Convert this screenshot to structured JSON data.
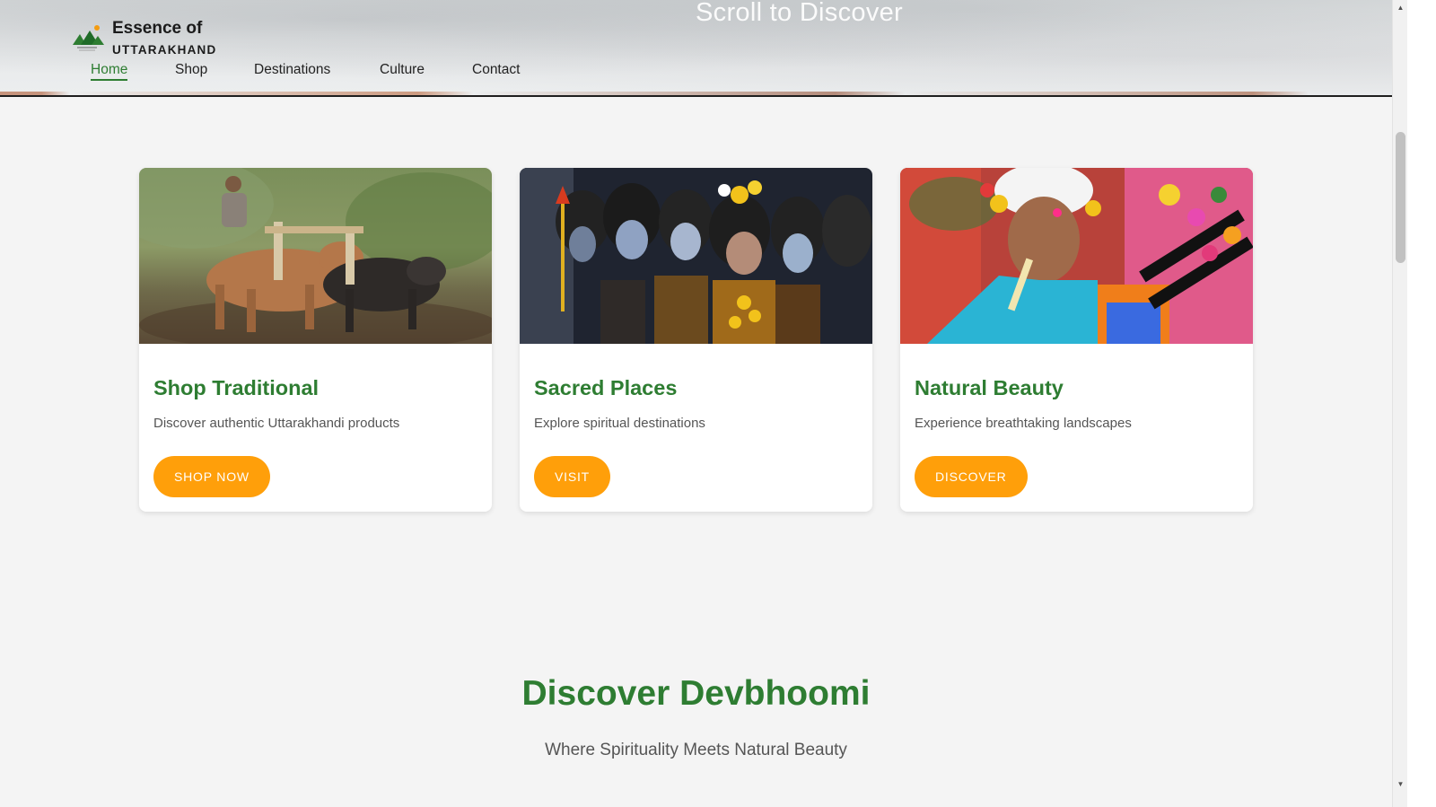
{
  "header": {
    "scroll_hint": "Scroll to Discover",
    "logo": {
      "line1": "Essence of",
      "line2": "UTTARAKHAND",
      "icon": "mountain-sun-logo"
    },
    "nav": [
      {
        "label": "Home",
        "active": true
      },
      {
        "label": "Shop",
        "active": false
      },
      {
        "label": "Destinations",
        "active": false
      },
      {
        "label": "Culture",
        "active": false
      },
      {
        "label": "Contact",
        "active": false
      }
    ]
  },
  "cards": [
    {
      "title": "Shop Traditional",
      "description": "Discover authentic Uttarakhandi products",
      "button": "SHOP NOW",
      "image": "farmer-plowing-with-oxen-photo"
    },
    {
      "title": "Sacred Places",
      "description": "Explore spiritual destinations",
      "button": "VISIT",
      "image": "children-dressed-as-shiva-photo"
    },
    {
      "title": "Natural Beauty",
      "description": "Experience breathtaking landscapes",
      "button": "DISCOVER",
      "image": "folk-musician-playing-bagpipe-photo"
    }
  ],
  "section": {
    "title": "Discover Devbhoomi",
    "subtitle": "Where Spirituality Meets Natural Beauty"
  },
  "colors": {
    "accent_green": "#2e7d32",
    "button_orange": "#ff9f0a",
    "page_bg": "#f4f4f4"
  }
}
